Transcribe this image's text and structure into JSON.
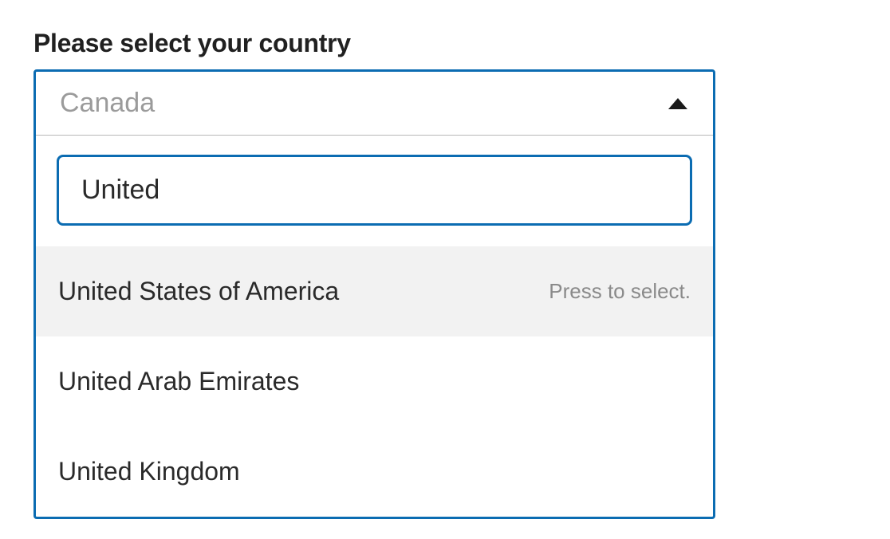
{
  "label": "Please select your country",
  "combobox": {
    "placeholder": "Canada",
    "search_value": "United",
    "highlight_hint": "Press to select.",
    "options": [
      {
        "label": "United States of America",
        "highlighted": true
      },
      {
        "label": "United Arab Emirates",
        "highlighted": false
      },
      {
        "label": "United Kingdom",
        "highlighted": false
      }
    ]
  }
}
